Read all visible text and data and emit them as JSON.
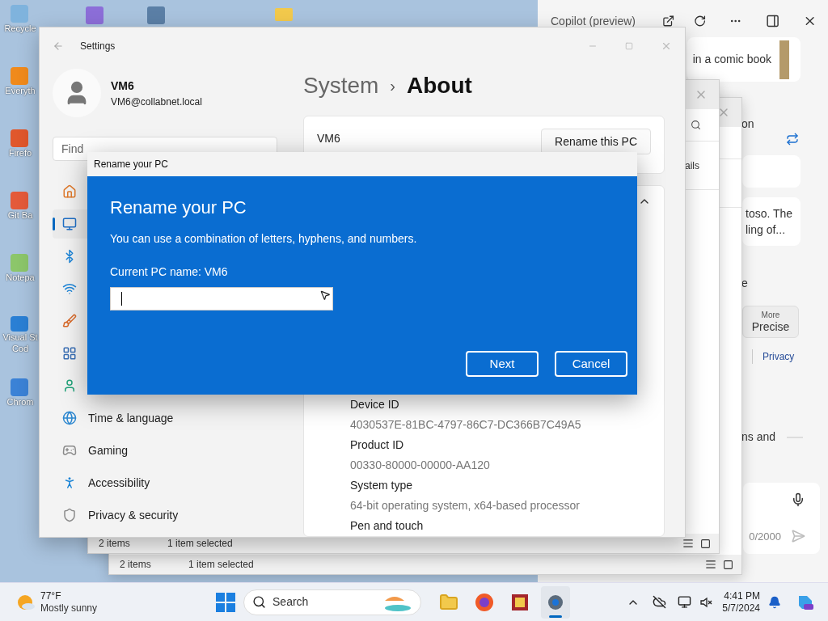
{
  "desktop_icons": [
    {
      "label": "Recycle"
    },
    {
      "label": "Everyth"
    },
    {
      "label": "Firefo"
    },
    {
      "label": "Git Ba"
    },
    {
      "label": "Notepa"
    },
    {
      "label": "Visual St\nCod"
    },
    {
      "label": "Chrom"
    }
  ],
  "copilot": {
    "title": "Copilot (preview)",
    "fragments": [
      "in a comic book",
      "on"
    ],
    "card_lines": [
      "toso. The",
      "ling of..."
    ],
    "fragment_2": "e",
    "style_button": {
      "small": "More",
      "label": "Precise"
    },
    "privacy_link": "Privacy",
    "fragment_3": "ns and",
    "counter": "0/2000"
  },
  "explorer_windows": [
    {
      "fragment": "ails",
      "status": [
        "2 items",
        "1 item selected"
      ]
    },
    {
      "status": [
        "2 items",
        "1 item selected"
      ]
    }
  ],
  "settings": {
    "title": "Settings",
    "user": {
      "name": "VM6",
      "email": "VM6@collabnet.local"
    },
    "search": {
      "placeholder": "Find"
    },
    "breadcrumb": {
      "parent": "System",
      "separator": "›",
      "current": "About"
    },
    "pc_card": {
      "name": "VM6",
      "button": "Rename this PC"
    },
    "nav": [
      {
        "selected": false
      },
      {
        "selected": true
      },
      {
        "selected": false
      },
      {
        "selected": false
      },
      {
        "selected": false
      },
      {
        "selected": false
      },
      {
        "selected": false
      },
      {
        "label": "Time & language",
        "selected": false
      },
      {
        "label": "Gaming",
        "selected": false
      },
      {
        "label": "Accessibility",
        "selected": false
      },
      {
        "label": "Privacy & security",
        "selected": false
      }
    ],
    "specs": [
      {
        "label": "Device ID",
        "value": "4030537E-81BC-4797-86C7-DC366B7C49A5"
      },
      {
        "label": "Product ID",
        "value": "00330-80000-00000-AA120"
      },
      {
        "label": "System type",
        "value": "64-bit operating system, x64-based processor"
      },
      {
        "label": "Pen and touch"
      }
    ]
  },
  "dialog": {
    "title": "Rename your PC",
    "heading": "Rename your PC",
    "description": "You can use a combination of letters, hyphens, and numbers.",
    "current_name": "Current PC name: VM6",
    "buttons": [
      "Next",
      "Cancel"
    ]
  },
  "taskbar": {
    "weather": {
      "temp": "77°F",
      "condition": "Mostly sunny"
    },
    "search": {
      "placeholder": "Search"
    },
    "time": "4:41 PM",
    "date": "5/7/2024"
  }
}
